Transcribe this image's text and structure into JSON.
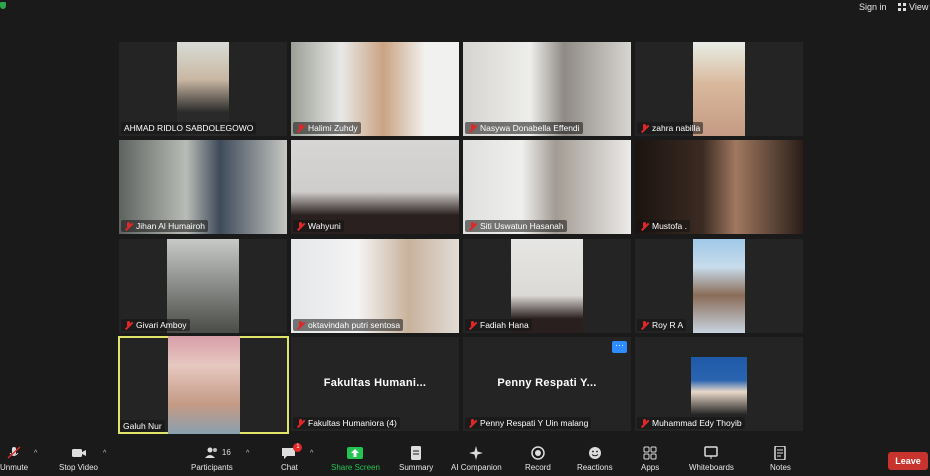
{
  "topbar": {
    "signin_label": "Sign in",
    "view_label": "View"
  },
  "participants": [
    {
      "name": "AHMAD RIDLO SABDOLEGOWO",
      "muted": false
    },
    {
      "name": "Halimi Zuhdy",
      "muted": true
    },
    {
      "name": "Nasywa Donabella Effendi",
      "muted": true
    },
    {
      "name": "zahra nabilla",
      "muted": true
    },
    {
      "name": "Jihan Al Humairoh",
      "muted": true
    },
    {
      "name": "Wahyuni",
      "muted": true
    },
    {
      "name": "Siti Uswatun Hasanah",
      "muted": true
    },
    {
      "name": "Mustofa .",
      "muted": true
    },
    {
      "name": "Givari Amboy",
      "muted": true
    },
    {
      "name": "oktavindah putri sentosa",
      "muted": true
    },
    {
      "name": "Fadiah Hana",
      "muted": true
    },
    {
      "name": "Roy R A",
      "muted": true
    },
    {
      "name": "Galuh Nur",
      "muted": false,
      "speaking": true
    },
    {
      "name": "Fakultas Humaniora (4)",
      "muted": true,
      "video_off_label": "Fakultas Humani..."
    },
    {
      "name": "Penny Respati Y Uin malang",
      "muted": true,
      "video_off_label": "Penny Respati Y...",
      "more_label": "···"
    },
    {
      "name": "Muhammad Edy Thoyib",
      "muted": true
    }
  ],
  "toolbar": {
    "unmute": "Unmute",
    "stop_video": "Stop Video",
    "participants": "Participants",
    "participants_count": "16",
    "chat": "Chat",
    "chat_badge": "1",
    "share_screen": "Share Screen",
    "summary": "Summary",
    "ai_companion": "AI Companion",
    "record": "Record",
    "reactions": "Reactions",
    "apps": "Apps",
    "whiteboards": "Whiteboards",
    "notes": "Notes",
    "leave": "Leave",
    "caret": "^"
  },
  "colors": {
    "accent": "#2d8cff",
    "share_green": "#23c552",
    "leave_red": "#c8332d",
    "speaker_outline": "#e0e56a",
    "mute_red": "#e02828"
  }
}
